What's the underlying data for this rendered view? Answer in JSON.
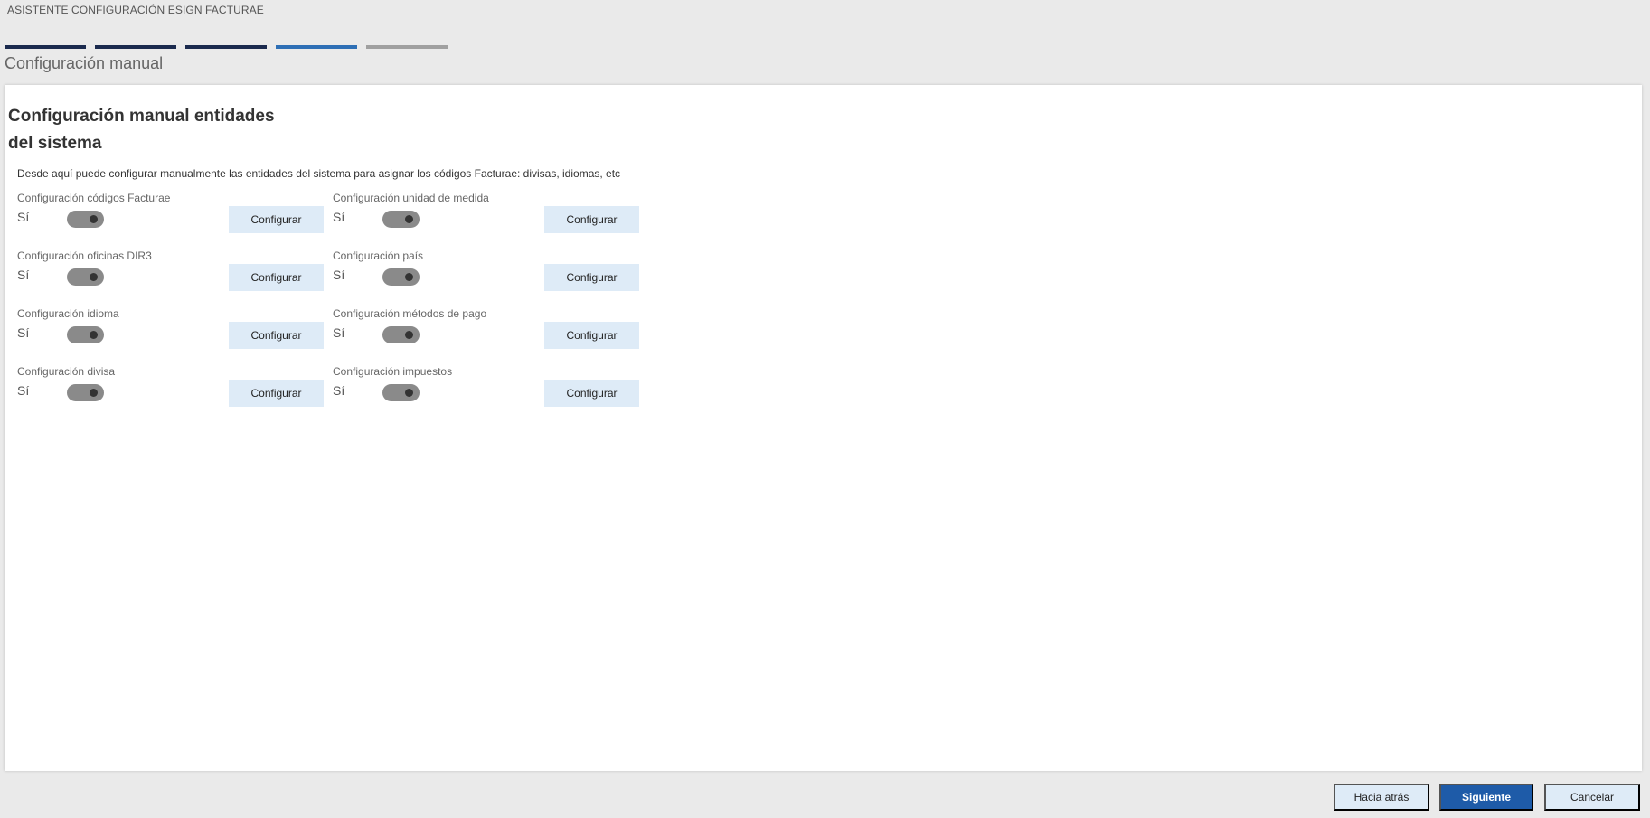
{
  "wizard": {
    "title": "ASISTENTE CONFIGURACIÓN ESIGN FACTURAE",
    "step_title": "Configuración manual",
    "progress": [
      {
        "state": "done",
        "color": "#1b2a4e"
      },
      {
        "state": "done",
        "color": "#1b2a4e"
      },
      {
        "state": "done",
        "color": "#1b2a4e"
      },
      {
        "state": "current",
        "color": "#2e6fb5"
      },
      {
        "state": "pending",
        "color": "#a0a0a0"
      }
    ]
  },
  "panel": {
    "heading": "Configuración manual entidades del sistema",
    "description": "Desde aquí puede configurar manualmente las entidades del sistema para asignar los códigos Facturae: divisas, idiomas, etc",
    "items": [
      {
        "label": "Configuración códigos Facturae",
        "value": "Sí",
        "enabled": true,
        "button": "Configurar"
      },
      {
        "label": "Configuración unidad de medida",
        "value": "Sí",
        "enabled": true,
        "button": "Configurar"
      },
      {
        "label": "Configuración oficinas DIR3",
        "value": "Sí",
        "enabled": true,
        "button": "Configurar"
      },
      {
        "label": "Configuración país",
        "value": "Sí",
        "enabled": true,
        "button": "Configurar"
      },
      {
        "label": "Configuración idioma",
        "value": "Sí",
        "enabled": true,
        "button": "Configurar"
      },
      {
        "label": "Configuración métodos de pago",
        "value": "Sí",
        "enabled": true,
        "button": "Configurar"
      },
      {
        "label": "Configuración divisa",
        "value": "Sí",
        "enabled": true,
        "button": "Configurar"
      },
      {
        "label": "Configuración impuestos",
        "value": "Sí",
        "enabled": true,
        "button": "Configurar"
      }
    ]
  },
  "footer": {
    "back_label": "Hacia atrás",
    "next_label": "Siguiente",
    "cancel_label": "Cancelar"
  },
  "colors": {
    "accent": "#1e5ba8",
    "button_light": "#deebf7",
    "toggle_on": "#8a8a8a"
  }
}
